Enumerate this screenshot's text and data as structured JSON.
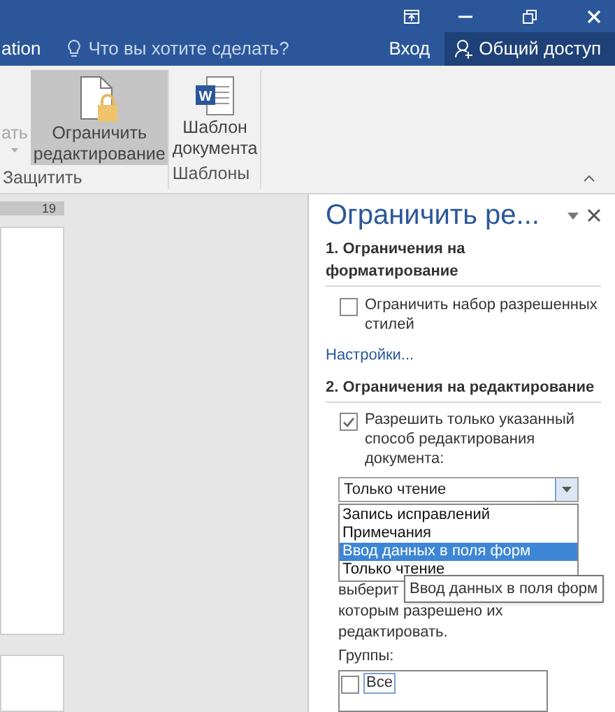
{
  "tab_bar": {
    "tab_cut": "ation",
    "search": {
      "placeholder": "Что вы хотите сделать?"
    },
    "sign_in": "Вход",
    "share": "Общий доступ"
  },
  "ribbon": {
    "groups": [
      {
        "label": "Защитить",
        "buttons": [
          {
            "kind": "cut",
            "lines": [
              "ать"
            ],
            "disabled": true,
            "selected": false
          },
          {
            "kind": "doc-lock",
            "lines": [
              "Ограничить",
              "редактирование"
            ],
            "disabled": false,
            "selected": true
          }
        ]
      },
      {
        "label": "Шаблоны",
        "buttons": [
          {
            "kind": "word",
            "icon_letter": "W",
            "lines": [
              "Шаблон",
              "документа"
            ],
            "disabled": false,
            "selected": false
          }
        ]
      }
    ]
  },
  "ruler": {
    "mark": "19"
  },
  "pane": {
    "title": "Ограничить ре...",
    "section_1": {
      "heading": "1. Ограничения на форматирование",
      "option": {
        "label": "Ограничить набор разрешенных стилей",
        "checked": false
      },
      "link": "Настройки..."
    },
    "section_2": {
      "heading": "2. Ограничения на редактирование",
      "option": {
        "label": "Разрешить только указанный способ редактирования документа:",
        "checked": true
      },
      "dropdown": {
        "value": "Только чтение",
        "expanded": true,
        "options": [
          {
            "label": "Запись исправлений",
            "highlighted": false
          },
          {
            "label": "Примечания",
            "highlighted": false
          },
          {
            "label": "Ввод данных в поля форм",
            "highlighted": true
          },
          {
            "label": "Только чтение",
            "highlighted": false
          }
        ]
      },
      "tooltip": "Ввод данных в поля форм",
      "exceptions_text": [
        "выберит",
        "которым разрешено их",
        "редактировать."
      ],
      "groups_label": "Группы:",
      "groups": [
        {
          "label": "Все",
          "checked": false
        }
      ]
    }
  }
}
